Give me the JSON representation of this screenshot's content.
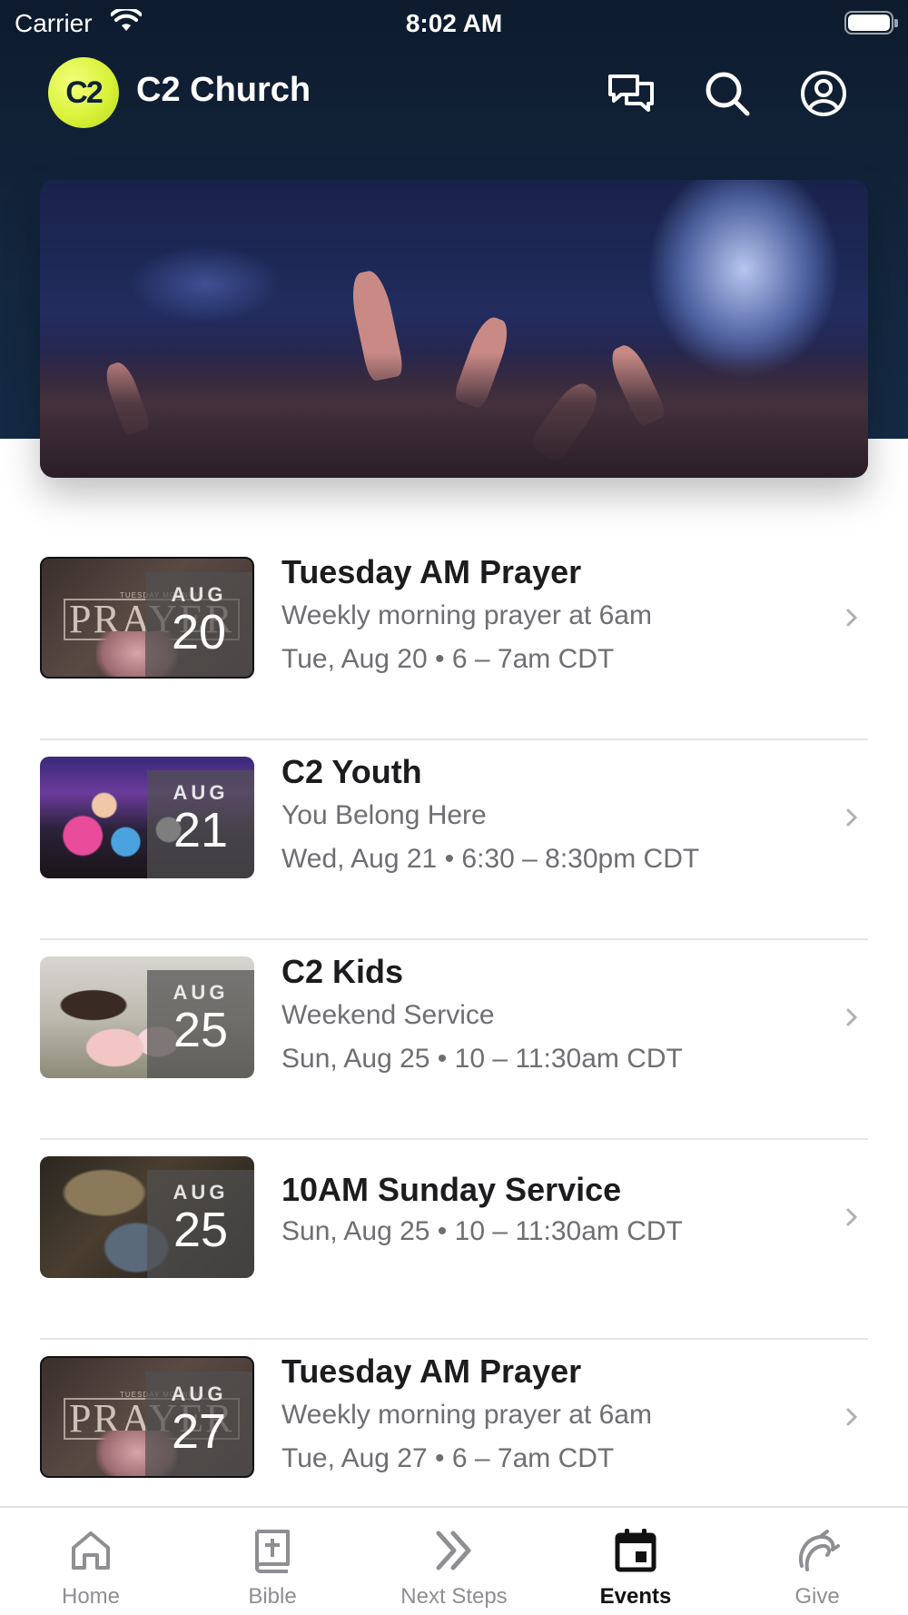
{
  "status_bar": {
    "carrier": "Carrier",
    "time": "8:02 AM"
  },
  "app": {
    "logo_text": "C2",
    "title": "C2 Church"
  },
  "header_icons": [
    "chat-icon",
    "search-icon",
    "profile-icon"
  ],
  "events": [
    {
      "title": "Tuesday AM Prayer",
      "subtitle": "Weekly morning prayer at 6am",
      "when": "Tue, Aug 20 • 6 – 7am CDT",
      "month": "AUG",
      "day": "20",
      "thumb": "prayer",
      "thumb_text": "PRAYER",
      "thumb_small": "TUESDAY MORNING"
    },
    {
      "title": "C2 Youth",
      "subtitle": "You Belong Here",
      "when": "Wed, Aug 21 • 6:30 – 8:30pm CDT",
      "month": "AUG",
      "day": "21",
      "thumb": "youth"
    },
    {
      "title": "C2 Kids",
      "subtitle": "Weekend Service",
      "when": "Sun, Aug 25 • 10 – 11:30am CDT",
      "month": "AUG",
      "day": "25",
      "thumb": "kids"
    },
    {
      "title": "10AM Sunday Service",
      "subtitle": "",
      "when": "Sun, Aug 25 • 10 – 11:30am CDT",
      "month": "AUG",
      "day": "25",
      "thumb": "service"
    },
    {
      "title": "Tuesday AM Prayer",
      "subtitle": "Weekly morning prayer at 6am",
      "when": "Tue, Aug 27 • 6 – 7am CDT",
      "month": "AUG",
      "day": "27",
      "thumb": "prayer",
      "thumb_text": "PRAYER",
      "thumb_small": "TUESDAY MORNING"
    }
  ],
  "tabs": [
    {
      "label": "Home",
      "icon": "home-icon",
      "active": false
    },
    {
      "label": "Bible",
      "icon": "bible-icon",
      "active": false
    },
    {
      "label": "Next Steps",
      "icon": "next-steps-icon",
      "active": false
    },
    {
      "label": "Events",
      "icon": "calendar-icon",
      "active": true
    },
    {
      "label": "Give",
      "icon": "give-icon",
      "active": false
    }
  ],
  "colors": {
    "header_bg": "#0e1b2e",
    "logo_accent": "#d9f23a",
    "text_secondary": "#6e6e73"
  }
}
